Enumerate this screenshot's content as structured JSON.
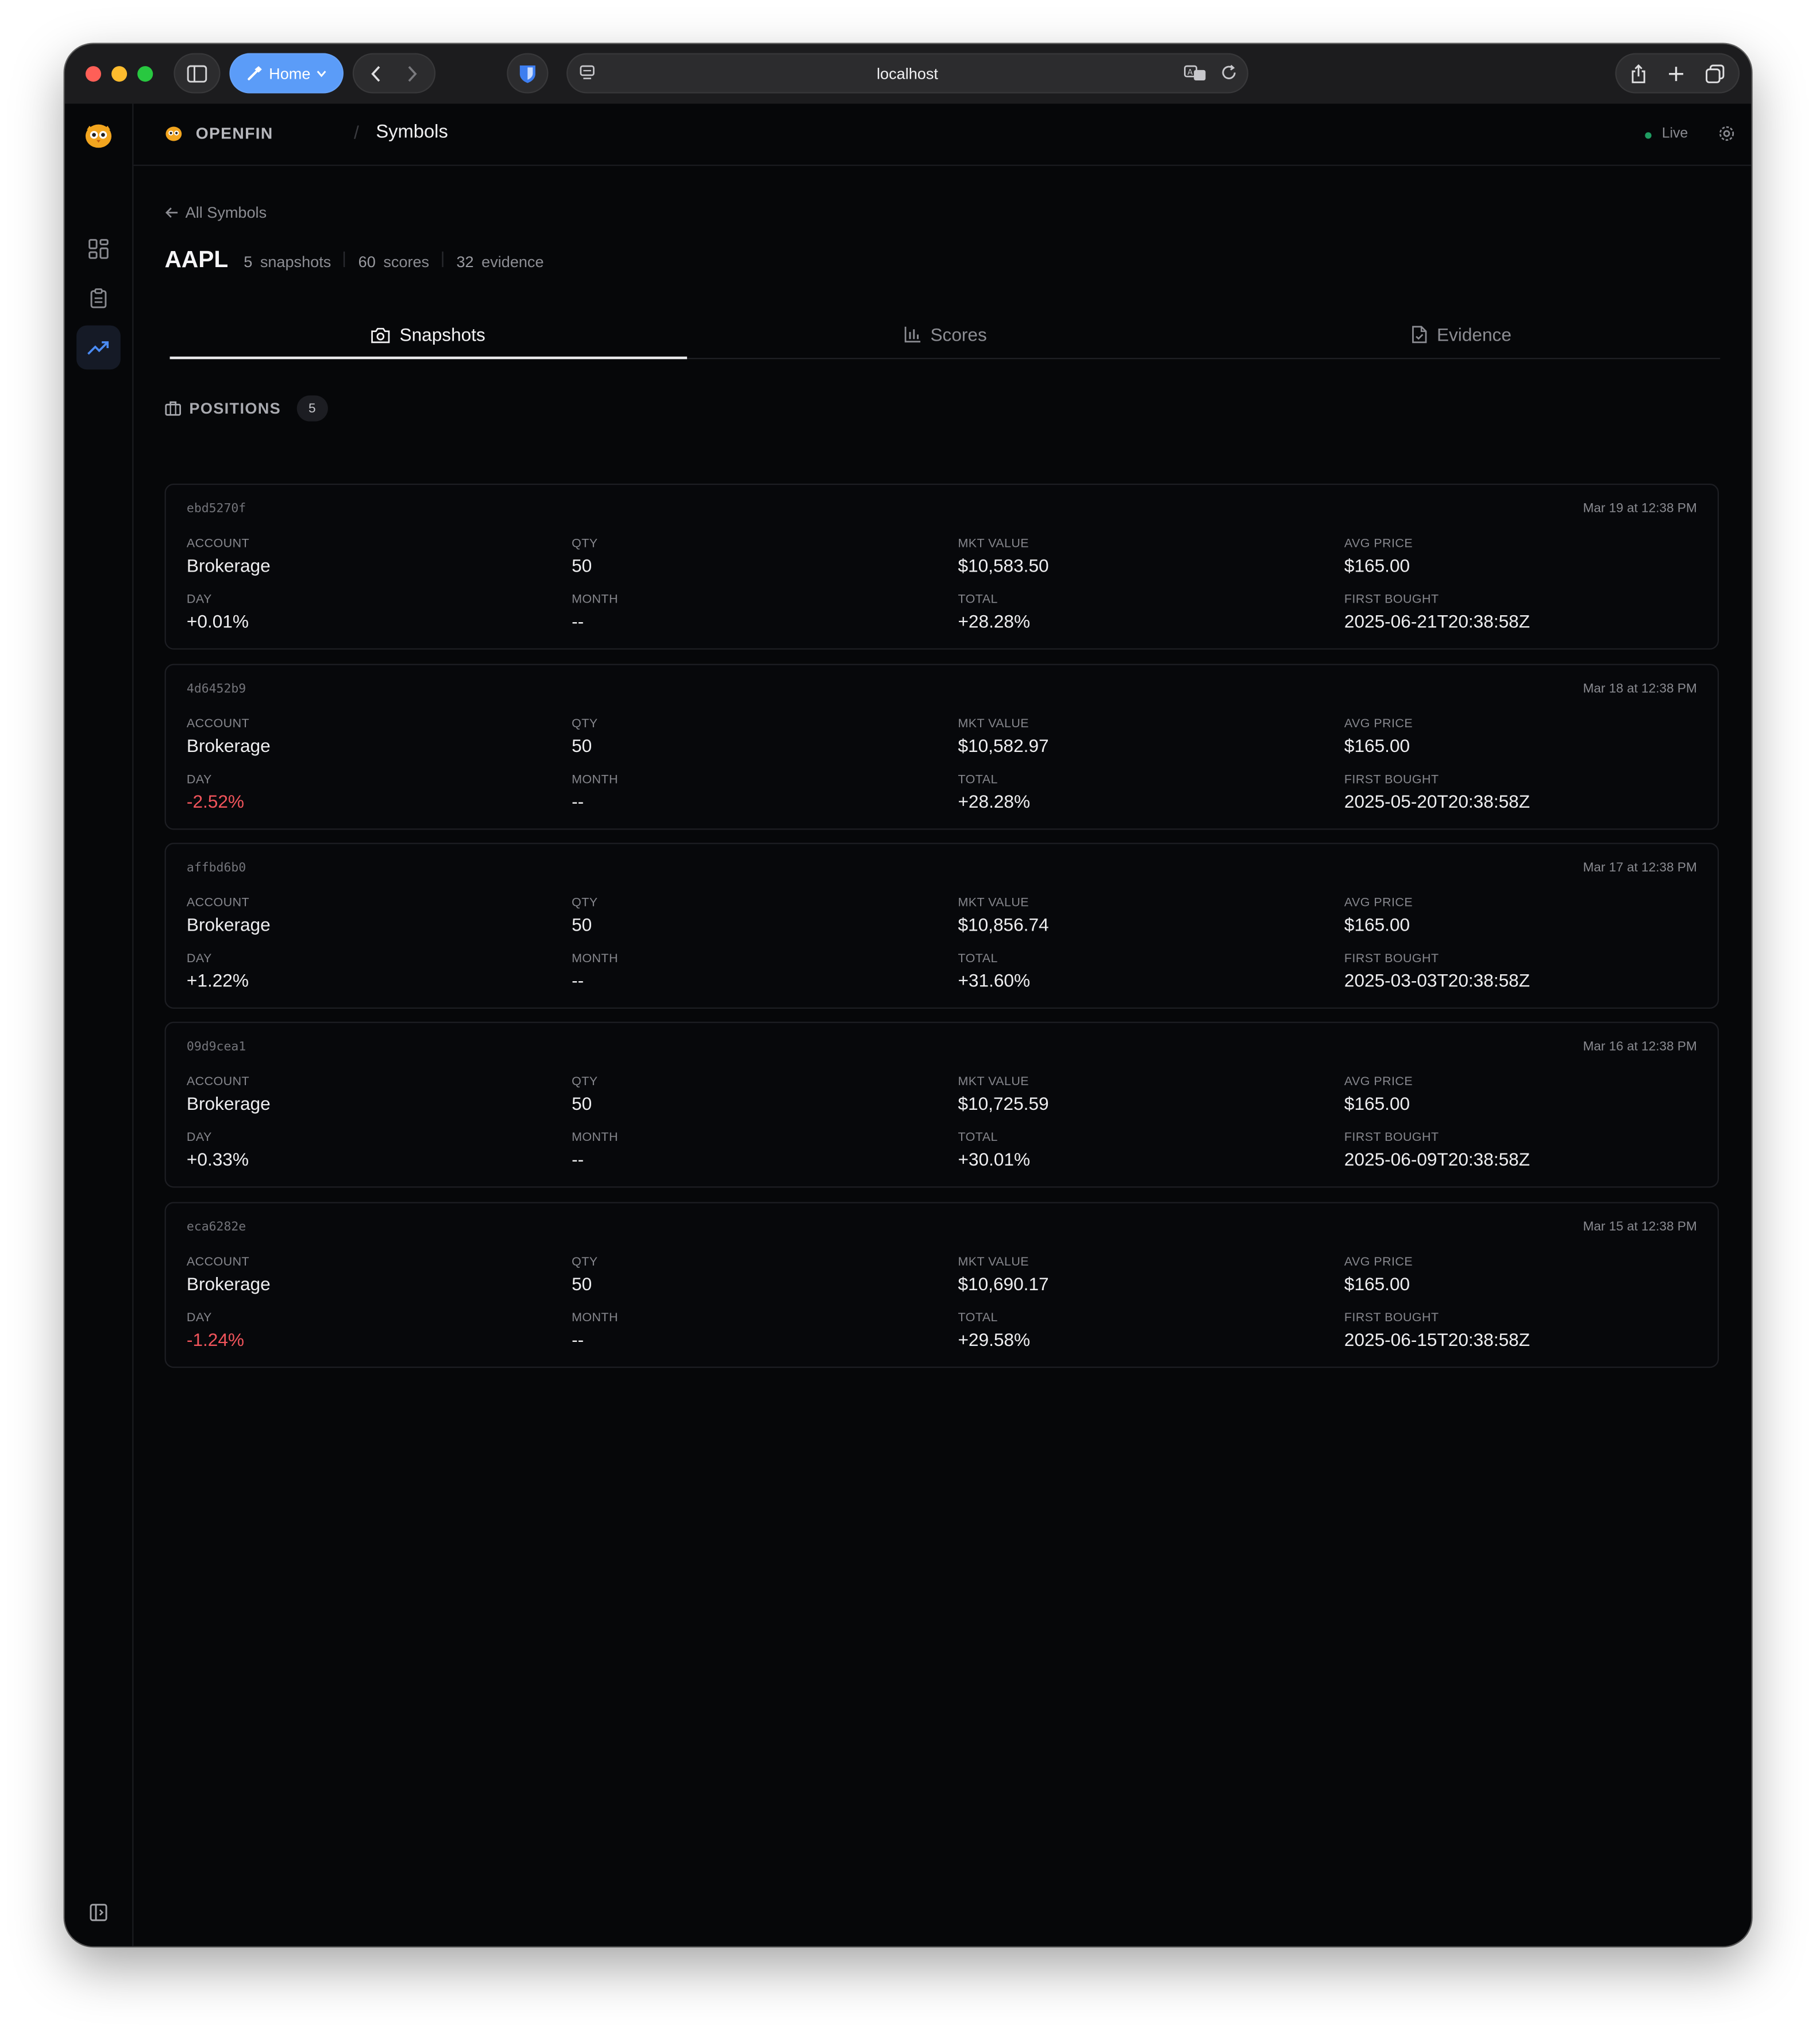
{
  "browser": {
    "home_label": "Home",
    "url": "localhost"
  },
  "app": {
    "brand": "OPENFIN",
    "breadcrumb_page": "Symbols",
    "status": "Live"
  },
  "page": {
    "back_label": "All Symbols",
    "symbol": "AAPL",
    "stats": [
      {
        "num": "5",
        "label": "snapshots"
      },
      {
        "num": "60",
        "label": "scores"
      },
      {
        "num": "32",
        "label": "evidence"
      }
    ],
    "tabs": [
      {
        "label": "Snapshots",
        "icon": "camera-icon",
        "active": true
      },
      {
        "label": "Scores",
        "icon": "bar-chart-icon",
        "active": false
      },
      {
        "label": "Evidence",
        "icon": "file-check-icon",
        "active": false
      }
    ],
    "section_title": "POSITIONS",
    "section_count": "5"
  },
  "labels": {
    "account": "ACCOUNT",
    "qty": "QTY",
    "mkt_value": "MKT VALUE",
    "avg_price": "AVG PRICE",
    "day": "DAY",
    "month": "MONTH",
    "total": "TOTAL",
    "first_bought": "FIRST BOUGHT"
  },
  "snapshots": [
    {
      "id": "ebd5270f",
      "time": "Mar 19 at 12:38 PM",
      "account": "Brokerage",
      "qty": "50",
      "mkt_value": "$10,583.50",
      "avg_price": "$165.00",
      "day": "+0.01%",
      "month": "--",
      "total": "+28.28%",
      "first_bought": "2025-06-21T20:38:58Z"
    },
    {
      "id": "4d6452b9",
      "time": "Mar 18 at 12:38 PM",
      "account": "Brokerage",
      "qty": "50",
      "mkt_value": "$10,582.97",
      "avg_price": "$165.00",
      "day": "-2.52%",
      "month": "--",
      "total": "+28.28%",
      "first_bought": "2025-05-20T20:38:58Z"
    },
    {
      "id": "affbd6b0",
      "time": "Mar 17 at 12:38 PM",
      "account": "Brokerage",
      "qty": "50",
      "mkt_value": "$10,856.74",
      "avg_price": "$165.00",
      "day": "+1.22%",
      "month": "--",
      "total": "+31.60%",
      "first_bought": "2025-03-03T20:38:58Z"
    },
    {
      "id": "09d9cea1",
      "time": "Mar 16 at 12:38 PM",
      "account": "Brokerage",
      "qty": "50",
      "mkt_value": "$10,725.59",
      "avg_price": "$165.00",
      "day": "+0.33%",
      "month": "--",
      "total": "+30.01%",
      "first_bought": "2025-06-09T20:38:58Z"
    },
    {
      "id": "eca6282e",
      "time": "Mar 15 at 12:38 PM",
      "account": "Brokerage",
      "qty": "50",
      "mkt_value": "$10,690.17",
      "avg_price": "$165.00",
      "day": "-1.24%",
      "month": "--",
      "total": "+29.58%",
      "first_bought": "2025-06-15T20:38:58Z"
    }
  ],
  "colors": {
    "background": "#060709",
    "negative": "#f0545b",
    "accent": "#5b9cf8",
    "live": "#1f9d62"
  }
}
